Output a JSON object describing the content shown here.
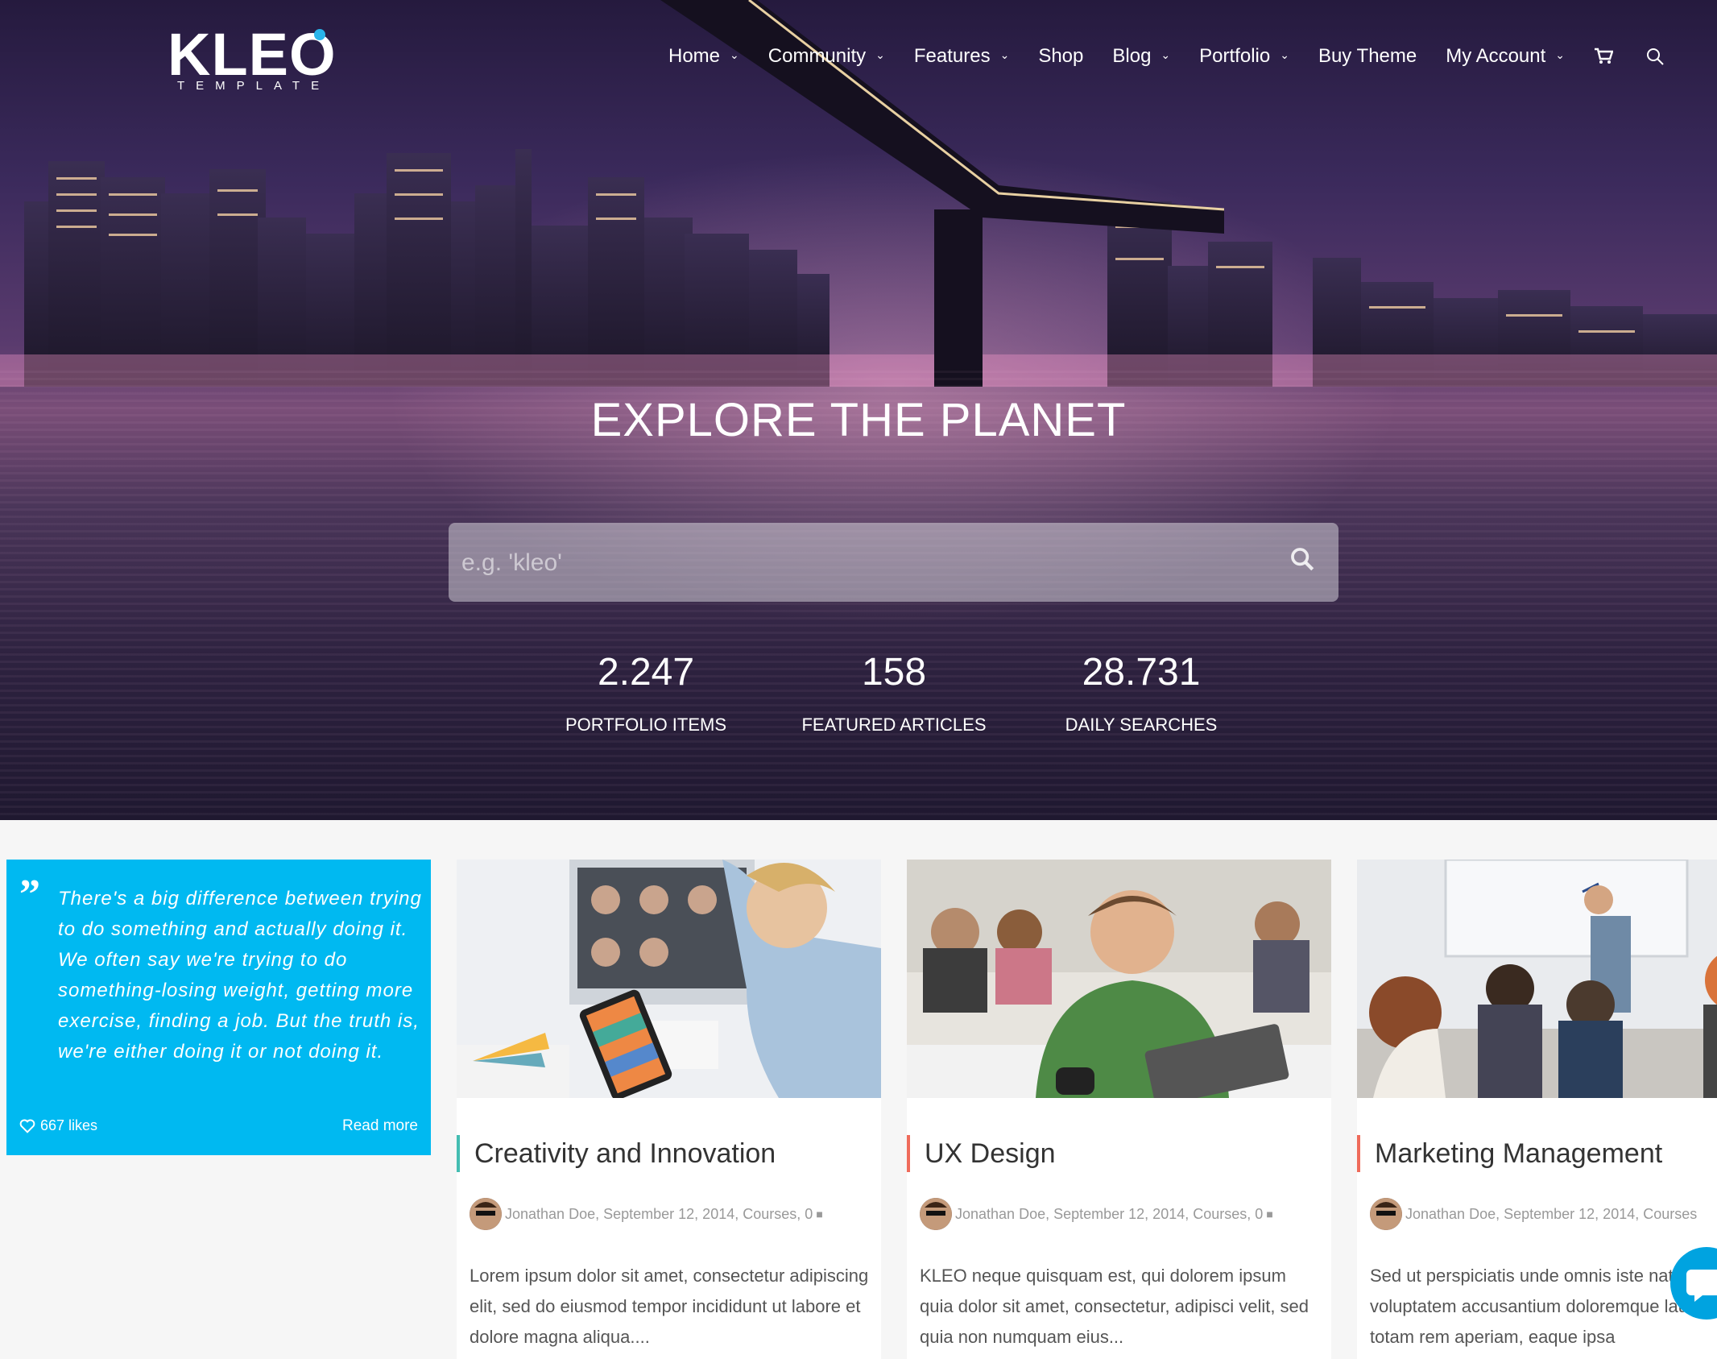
{
  "brand": {
    "name": "KLEO",
    "tagline": "TEMPLATE",
    "accent_color": "#28b4ea"
  },
  "nav": {
    "items": [
      {
        "label": "Home",
        "has_dropdown": true
      },
      {
        "label": "Community",
        "has_dropdown": true
      },
      {
        "label": "Features",
        "has_dropdown": true
      },
      {
        "label": "Shop",
        "has_dropdown": false
      },
      {
        "label": "Blog",
        "has_dropdown": true
      },
      {
        "label": "Portfolio",
        "has_dropdown": true
      },
      {
        "label": "Buy Theme",
        "has_dropdown": false
      },
      {
        "label": "My Account",
        "has_dropdown": true
      }
    ],
    "icons": [
      "cart-icon",
      "search-icon"
    ]
  },
  "hero": {
    "title": "EXPLORE THE PLANET",
    "search_placeholder": "e.g. 'kleo'",
    "stats": [
      {
        "value": "2.247",
        "label": "PORTFOLIO ITEMS"
      },
      {
        "value": "158",
        "label": "FEATURED ARTICLES"
      },
      {
        "value": "28.731",
        "label": "DAILY SEARCHES"
      }
    ]
  },
  "quote_card": {
    "text": "There's a big difference between trying to do something and actually doing it. We often say we're trying to do something-losing weight, getting more exercise, finding a job. But the truth is, we're either doing it or not doing it.",
    "likes": "667 likes",
    "read_more": "Read more",
    "color": "#00b9f1"
  },
  "posts": [
    {
      "title": "Creativity and Innovation",
      "accent": "#44bdb2",
      "meta": {
        "author": "Jonathan Doe",
        "date": "September 12, 2014",
        "category": "Courses",
        "comments": "0"
      },
      "excerpt": "Lorem ipsum dolor sit amet, consectetur adipiscing elit, sed do eiusmod tempor incididunt ut labore et dolore magna aliqua...."
    },
    {
      "title": "UX Design",
      "accent": "#ef6b5b",
      "meta": {
        "author": "Jonathan Doe",
        "date": "September 12, 2014",
        "category": "Courses",
        "comments": "0"
      },
      "excerpt": "KLEO neque quisquam est, qui dolorem ipsum quia dolor sit amet, consectetur, adipisci velit, sed quia non numquam eius..."
    },
    {
      "title": "Marketing Management",
      "accent": "#ef6b5b",
      "meta": {
        "author": "Jonathan Doe",
        "date": "September 12, 2014",
        "category": "Courses",
        "comments": ""
      },
      "excerpt": "Sed ut perspiciatis unde omnis iste natus error sit voluptatem accusantium doloremque laudantium, totam rem aperiam, eaque ipsa"
    }
  ]
}
